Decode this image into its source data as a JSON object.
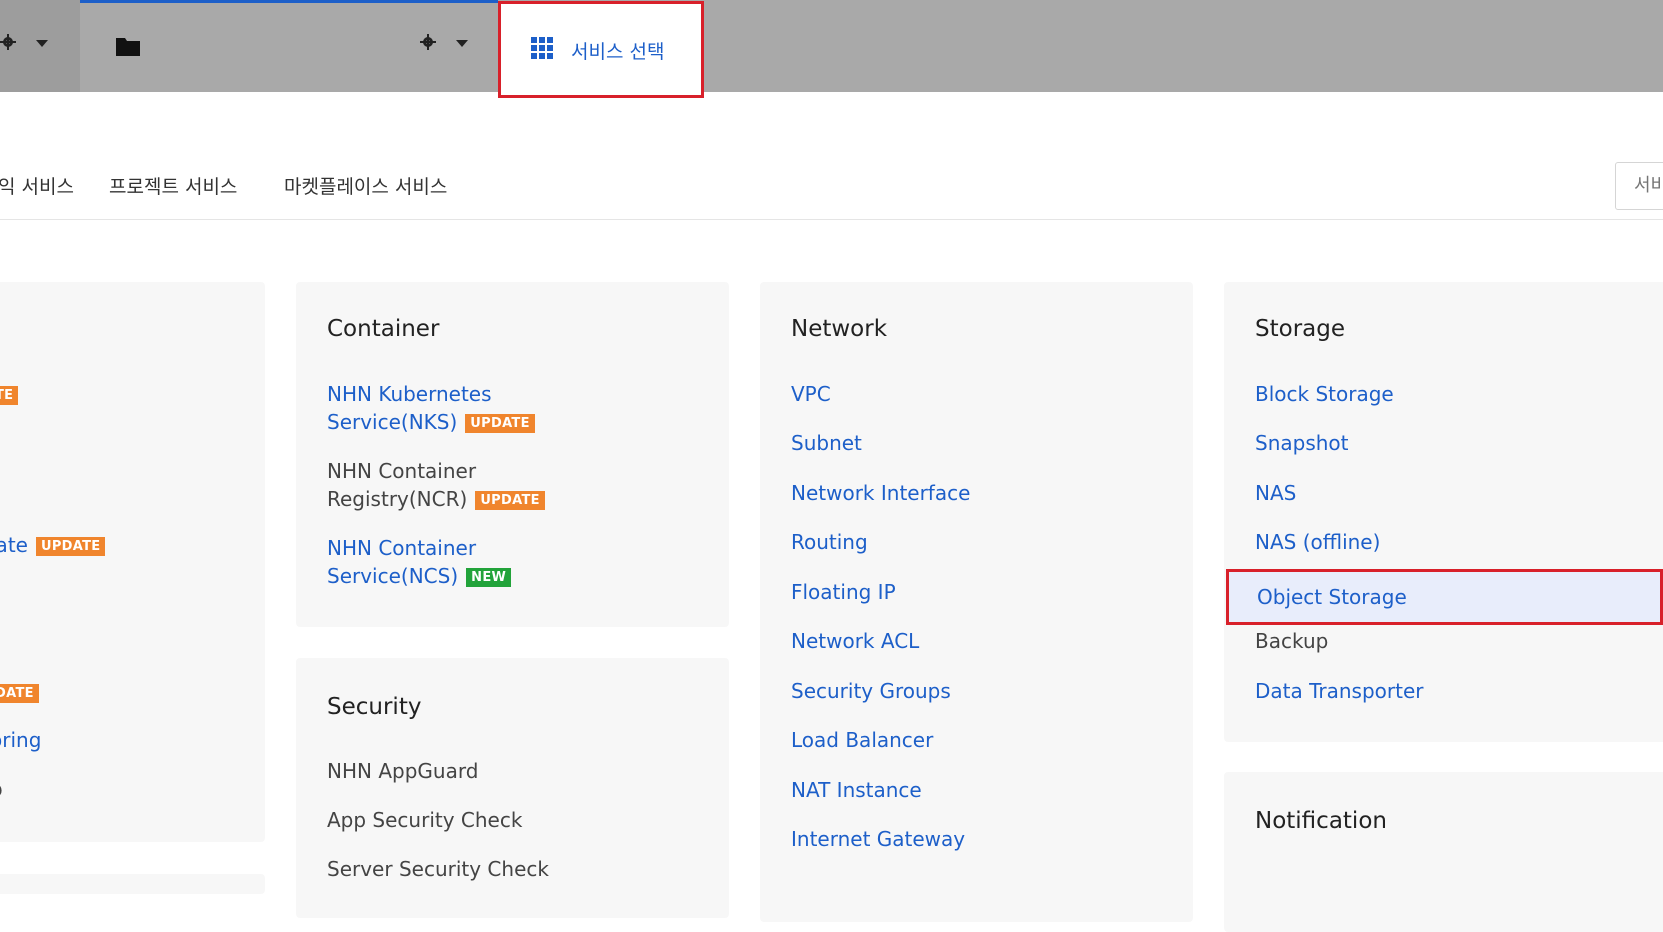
{
  "topbar": {
    "service_select_label": "서비스 선택"
  },
  "category_tabs": [
    {
      "label": "익 서비스"
    },
    {
      "label": "프로젝트 서비스"
    },
    {
      "label": "마켓플레이스 서비스"
    }
  ],
  "search": {
    "placeholder": "서비"
  },
  "left_panel": {
    "badge1": "TE",
    "item_late": "late",
    "badge2": "UPDATE",
    "badge3": "DATE",
    "item_oring": "oring",
    "item_p": "p"
  },
  "container": {
    "title": "Container",
    "items": [
      {
        "line1": "NHN Kubernetes",
        "line2": "Service(NKS)",
        "badge": "UPDATE"
      },
      {
        "line1": "NHN Container",
        "line2": "Registry(NCR)",
        "badge": "UPDATE"
      },
      {
        "line1": "NHN Container",
        "line2": "Service(NCS)",
        "badge": "NEW"
      }
    ]
  },
  "security": {
    "title": "Security",
    "items": [
      "NHN AppGuard",
      "App Security Check",
      "Server Security Check"
    ]
  },
  "network": {
    "title": "Network",
    "items": [
      "VPC",
      "Subnet",
      "Network Interface",
      "Routing",
      "Floating IP",
      "Network ACL",
      "Security Groups",
      "Load Balancer",
      "NAT Instance",
      "Internet Gateway"
    ]
  },
  "storage": {
    "title": "Storage",
    "items": [
      "Block Storage",
      "Snapshot",
      "NAS",
      "NAS (offline)",
      "Object Storage",
      "Backup",
      "Data Transporter"
    ]
  },
  "notification": {
    "title": "Notification"
  }
}
